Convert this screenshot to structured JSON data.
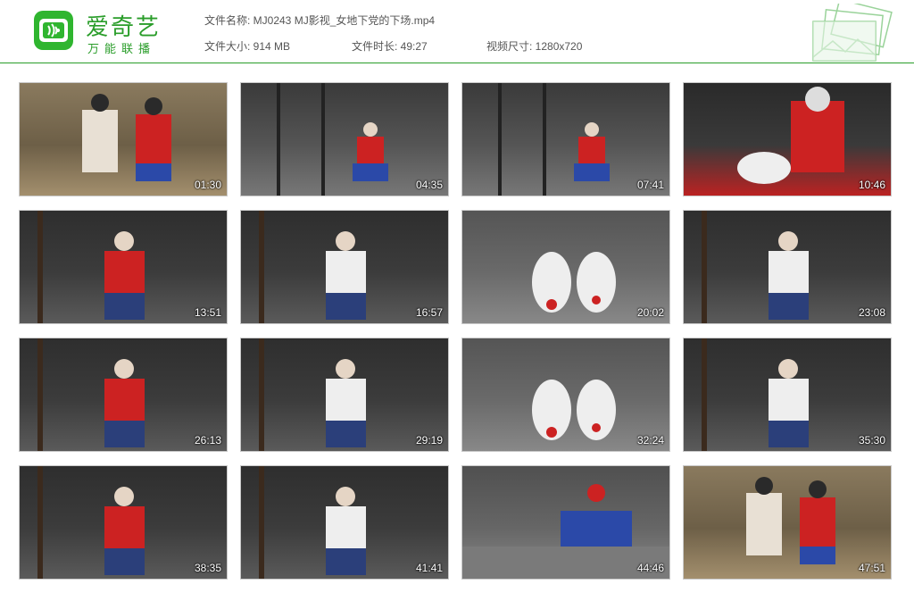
{
  "brand": {
    "name": "爱奇艺",
    "slogan": "万能联播",
    "logo_color": "#2fb52f"
  },
  "info": {
    "file_name": "文件名称:  MJ0243 MJ影视_女地下党的下场.mp4",
    "file_size": "文件大小:  914 MB",
    "duration": "文件时长:  49:27",
    "resolution": "视频尺寸:  1280x720"
  },
  "thumbnails": [
    {
      "time": "01:30",
      "scene": "outdoor"
    },
    {
      "time": "04:35",
      "scene": "cell"
    },
    {
      "time": "07:41",
      "scene": "cell"
    },
    {
      "time": "10:46",
      "scene": "closeup"
    },
    {
      "time": "13:51",
      "scene": "room"
    },
    {
      "time": "16:57",
      "scene": "room"
    },
    {
      "time": "20:02",
      "scene": "feet"
    },
    {
      "time": "23:08",
      "scene": "room"
    },
    {
      "time": "26:13",
      "scene": "room"
    },
    {
      "time": "29:19",
      "scene": "room"
    },
    {
      "time": "32:24",
      "scene": "feet"
    },
    {
      "time": "35:30",
      "scene": "room"
    },
    {
      "time": "38:35",
      "scene": "room"
    },
    {
      "time": "41:41",
      "scene": "room"
    },
    {
      "time": "44:46",
      "scene": "floor"
    },
    {
      "time": "47:51",
      "scene": "outdoor"
    }
  ],
  "colors": {
    "accent": "#2a9d2a",
    "border": "#c9c9c9"
  }
}
